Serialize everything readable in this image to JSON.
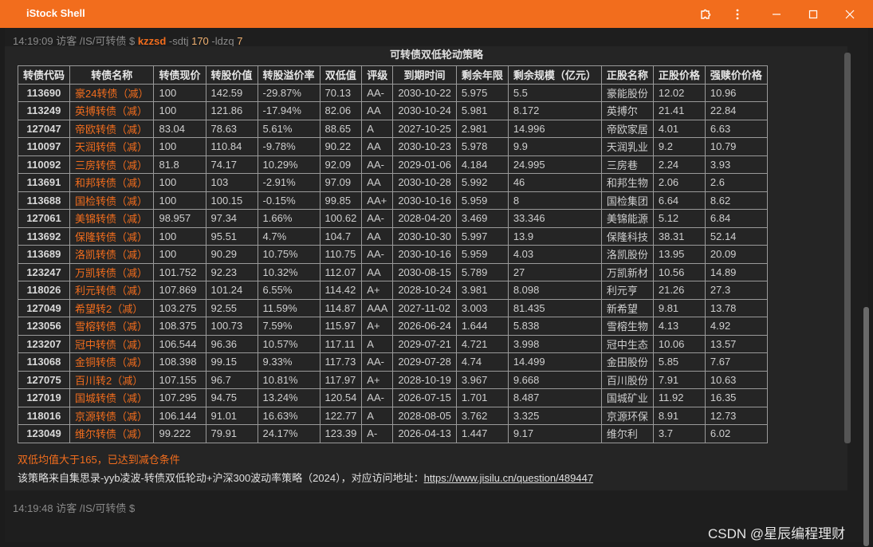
{
  "window": {
    "title": "iStock Shell"
  },
  "prompt1": {
    "time": "14:19:09",
    "user": "访客",
    "path": "/IS/可转债",
    "symbol": "$",
    "command": "kzzsd",
    "arg1": "-sdtj",
    "val1": "170",
    "arg2": "-ldzq",
    "val2": "7"
  },
  "table": {
    "title": "可转债双低轮动策略",
    "headers": [
      "转债代码",
      "转债名称",
      "转债现价",
      "转股价值",
      "转股溢价率",
      "双低值",
      "评级",
      "到期时间",
      "剩余年限",
      "剩余规模（亿元）",
      "正股名称",
      "正股价格",
      "强赎价价格"
    ],
    "rows": [
      [
        "113690",
        "豪24转债（减）",
        "100",
        "142.59",
        "-29.87%",
        "70.13",
        "AA-",
        "2030-10-22",
        "5.975",
        "5.5",
        "豪能股份",
        "12.02",
        "10.96"
      ],
      [
        "113249",
        "英搏转债（减）",
        "100",
        "121.86",
        "-17.94%",
        "82.06",
        "AA",
        "2030-10-24",
        "5.981",
        "8.172",
        "英搏尔",
        "21.41",
        "22.84"
      ],
      [
        "127047",
        "帝欧转债（减）",
        "83.04",
        "78.63",
        "5.61%",
        "88.65",
        "A",
        "2027-10-25",
        "2.981",
        "14.996",
        "帝欧家居",
        "4.01",
        "6.63"
      ],
      [
        "110097",
        "天润转债（减）",
        "100",
        "110.84",
        "-9.78%",
        "90.22",
        "AA",
        "2030-10-23",
        "5.978",
        "9.9",
        "天润乳业",
        "9.2",
        "10.79"
      ],
      [
        "110092",
        "三房转债（减）",
        "81.8",
        "74.17",
        "10.29%",
        "92.09",
        "AA-",
        "2029-01-06",
        "4.184",
        "24.995",
        "三房巷",
        "2.24",
        "3.93"
      ],
      [
        "113691",
        "和邦转债（减）",
        "100",
        "103",
        "-2.91%",
        "97.09",
        "AA",
        "2030-10-28",
        "5.992",
        "46",
        "和邦生物",
        "2.06",
        "2.6"
      ],
      [
        "113688",
        "国检转债（减）",
        "100",
        "100.15",
        "-0.15%",
        "99.85",
        "AA+",
        "2030-10-16",
        "5.959",
        "8",
        "国检集团",
        "6.64",
        "8.62"
      ],
      [
        "127061",
        "美锦转债（减）",
        "98.957",
        "97.34",
        "1.66%",
        "100.62",
        "AA-",
        "2028-04-20",
        "3.469",
        "33.346",
        "美锦能源",
        "5.12",
        "6.84"
      ],
      [
        "113692",
        "保隆转债（减）",
        "100",
        "95.51",
        "4.7%",
        "104.7",
        "AA",
        "2030-10-30",
        "5.997",
        "13.9",
        "保隆科技",
        "38.31",
        "52.14"
      ],
      [
        "113689",
        "洛凯转债（减）",
        "100",
        "90.29",
        "10.75%",
        "110.75",
        "AA-",
        "2030-10-16",
        "5.959",
        "4.03",
        "洛凯股份",
        "13.95",
        "20.09"
      ],
      [
        "123247",
        "万凯转债（减）",
        "101.752",
        "92.23",
        "10.32%",
        "112.07",
        "AA",
        "2030-08-15",
        "5.789",
        "27",
        "万凯新材",
        "10.56",
        "14.89"
      ],
      [
        "118026",
        "利元转债（减）",
        "107.869",
        "101.24",
        "6.55%",
        "114.42",
        "A+",
        "2028-10-24",
        "3.981",
        "8.098",
        "利元亨",
        "21.26",
        "27.3"
      ],
      [
        "127049",
        "希望转2（减）",
        "103.275",
        "92.55",
        "11.59%",
        "114.87",
        "AAA",
        "2027-11-02",
        "3.003",
        "81.435",
        "新希望",
        "9.81",
        "13.78"
      ],
      [
        "123056",
        "雪榕转债（减）",
        "108.375",
        "100.73",
        "7.59%",
        "115.97",
        "A+",
        "2026-06-24",
        "1.644",
        "5.838",
        "雪榕生物",
        "4.13",
        "4.92"
      ],
      [
        "123207",
        "冠中转债（减）",
        "106.544",
        "96.36",
        "10.57%",
        "117.11",
        "A",
        "2029-07-21",
        "4.721",
        "3.998",
        "冠中生态",
        "10.06",
        "13.57"
      ],
      [
        "113068",
        "金铜转债（减）",
        "108.398",
        "99.15",
        "9.33%",
        "117.73",
        "AA-",
        "2029-07-28",
        "4.74",
        "14.499",
        "金田股份",
        "5.85",
        "7.67"
      ],
      [
        "127075",
        "百川转2（减）",
        "107.155",
        "96.7",
        "10.81%",
        "117.97",
        "A+",
        "2028-10-19",
        "3.967",
        "9.668",
        "百川股份",
        "7.91",
        "10.63"
      ],
      [
        "127019",
        "国城转债（减）",
        "107.295",
        "94.75",
        "13.24%",
        "120.54",
        "AA-",
        "2026-07-15",
        "1.701",
        "8.487",
        "国城矿业",
        "11.92",
        "16.35"
      ],
      [
        "118016",
        "京源转债（减）",
        "106.144",
        "91.01",
        "16.63%",
        "122.77",
        "A",
        "2028-08-05",
        "3.762",
        "3.325",
        "京源环保",
        "8.91",
        "12.73"
      ],
      [
        "123049",
        "维尔转债（减）",
        "99.222",
        "79.91",
        "24.17%",
        "123.39",
        "A-",
        "2026-04-13",
        "1.447",
        "9.17",
        "维尔利",
        "3.7",
        "6.02"
      ]
    ]
  },
  "notes": {
    "warning": "双低均值大于165，已达到减仓条件",
    "source_prefix": "该策略来自集思录-yyb凌波-转债双低轮动+沪深300波动率策略（2024），对应访问地址：",
    "source_url": "https://www.jisilu.cn/question/489447"
  },
  "prompt2": {
    "time": "14:19:48",
    "user": "访客",
    "path": "/IS/可转债",
    "symbol": "$"
  },
  "watermark": "CSDN @星辰编程理财"
}
